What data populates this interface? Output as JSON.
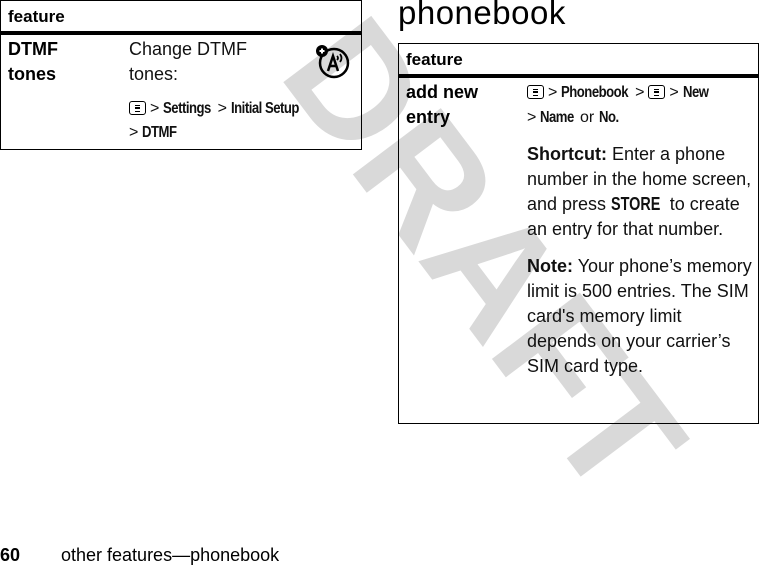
{
  "watermark": {
    "text": "DRAFT",
    "color": "#d9d9d9"
  },
  "left_table": {
    "header": "feature",
    "rows": [
      {
        "feature": [
          "DTMF",
          "tones"
        ],
        "description": [
          "Change DTMF",
          "tones:"
        ],
        "icon": "network-feature-icon",
        "path": [
          "menu-key",
          "Settings",
          "Initial Setup",
          "DTMF"
        ]
      }
    ]
  },
  "section_title": "phonebook",
  "right_table": {
    "header": "feature",
    "rows": [
      {
        "feature": [
          "add new",
          "entry"
        ],
        "path_line1": [
          "menu-key",
          "Phonebook",
          "menu-key",
          "New"
        ],
        "path_line2": {
          "a": "Name",
          "or": "or",
          "b": "No."
        },
        "shortcut": {
          "label": "Shortcut:",
          "text_before": "Enter a phone number in the home screen, and press",
          "key": "STORE",
          "text_after": "to create an entry for that number."
        },
        "note": {
          "label": "Note:",
          "text": "Your phone’s memory limit is 500 entries. The SIM card's memory limit depends on your carrier’s SIM card type."
        }
      }
    ]
  },
  "footer": {
    "page_number": "60",
    "running_title": "other features—phonebook"
  }
}
